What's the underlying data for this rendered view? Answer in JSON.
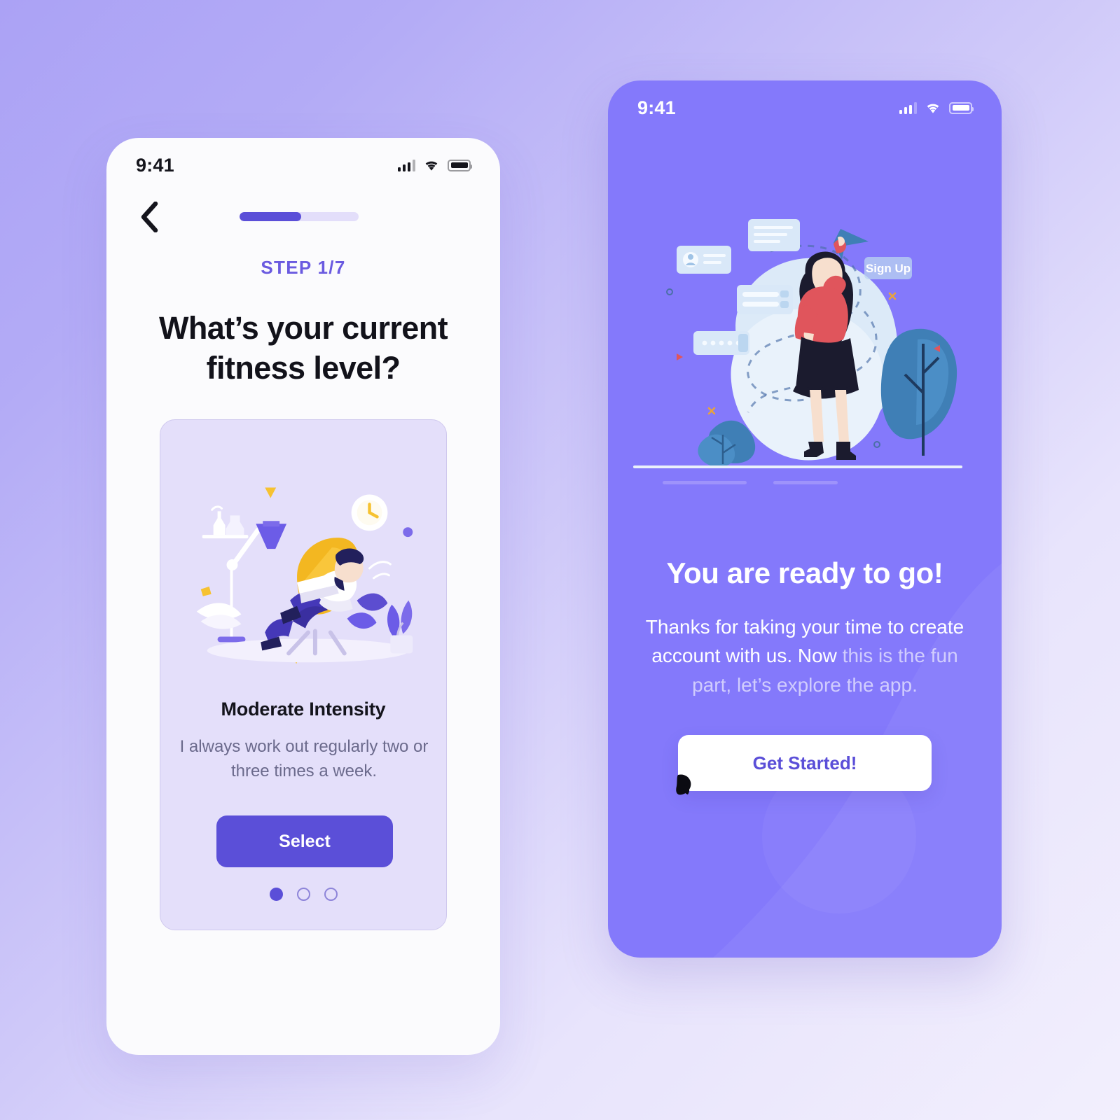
{
  "background": {
    "gradient_from": "#ABA2F5",
    "gradient_to": "#F2EFFD"
  },
  "theme": {
    "primary": "#5B4FD8",
    "step_label_color": "#6A5AE0",
    "phone_right_bg": "#8479FB",
    "phone_left_bg": "#FBFBFD",
    "card_bg": "#E4DFFA",
    "card_border": "#CFC8EE"
  },
  "screen_onboarding": {
    "status_bar": {
      "time": "9:41",
      "signal_icon": "signal-bars-icon",
      "wifi_icon": "wifi-icon",
      "battery_icon": "battery-full-icon"
    },
    "back_icon": "chevron-left-icon",
    "progress": {
      "percent": 52,
      "label": "52%"
    },
    "step_label": "STEP 1/7",
    "question": "What’s your current fitness level?",
    "card": {
      "illustration": "man-relaxing-in-chair-with-laptop-illustration",
      "title": "Moderate Intensity",
      "description": "I always work out regularly two or three times a week.",
      "select_label": "Select",
      "pager": {
        "total": 3,
        "active_index": 0
      }
    }
  },
  "screen_ready": {
    "status_bar": {
      "time": "9:41",
      "signal_icon": "signal-bars-icon",
      "wifi_icon": "wifi-icon",
      "battery_icon": "battery-full-icon"
    },
    "illustration": "woman-signing-up-with-floating-ui-cards-illustration",
    "illustration_label": "Sign Up",
    "title": "You are ready to go!",
    "body_bright": "Thanks for taking your time to create account with us. Now ",
    "body_dim": "this is the fun part, let’s explore the app.",
    "body_full": "Thanks for taking your time to create account with us. Now this is the fun part, let’s explore the app.",
    "get_started_label": "Get Started!",
    "cursor_icon": "mouse-cursor-icon"
  }
}
